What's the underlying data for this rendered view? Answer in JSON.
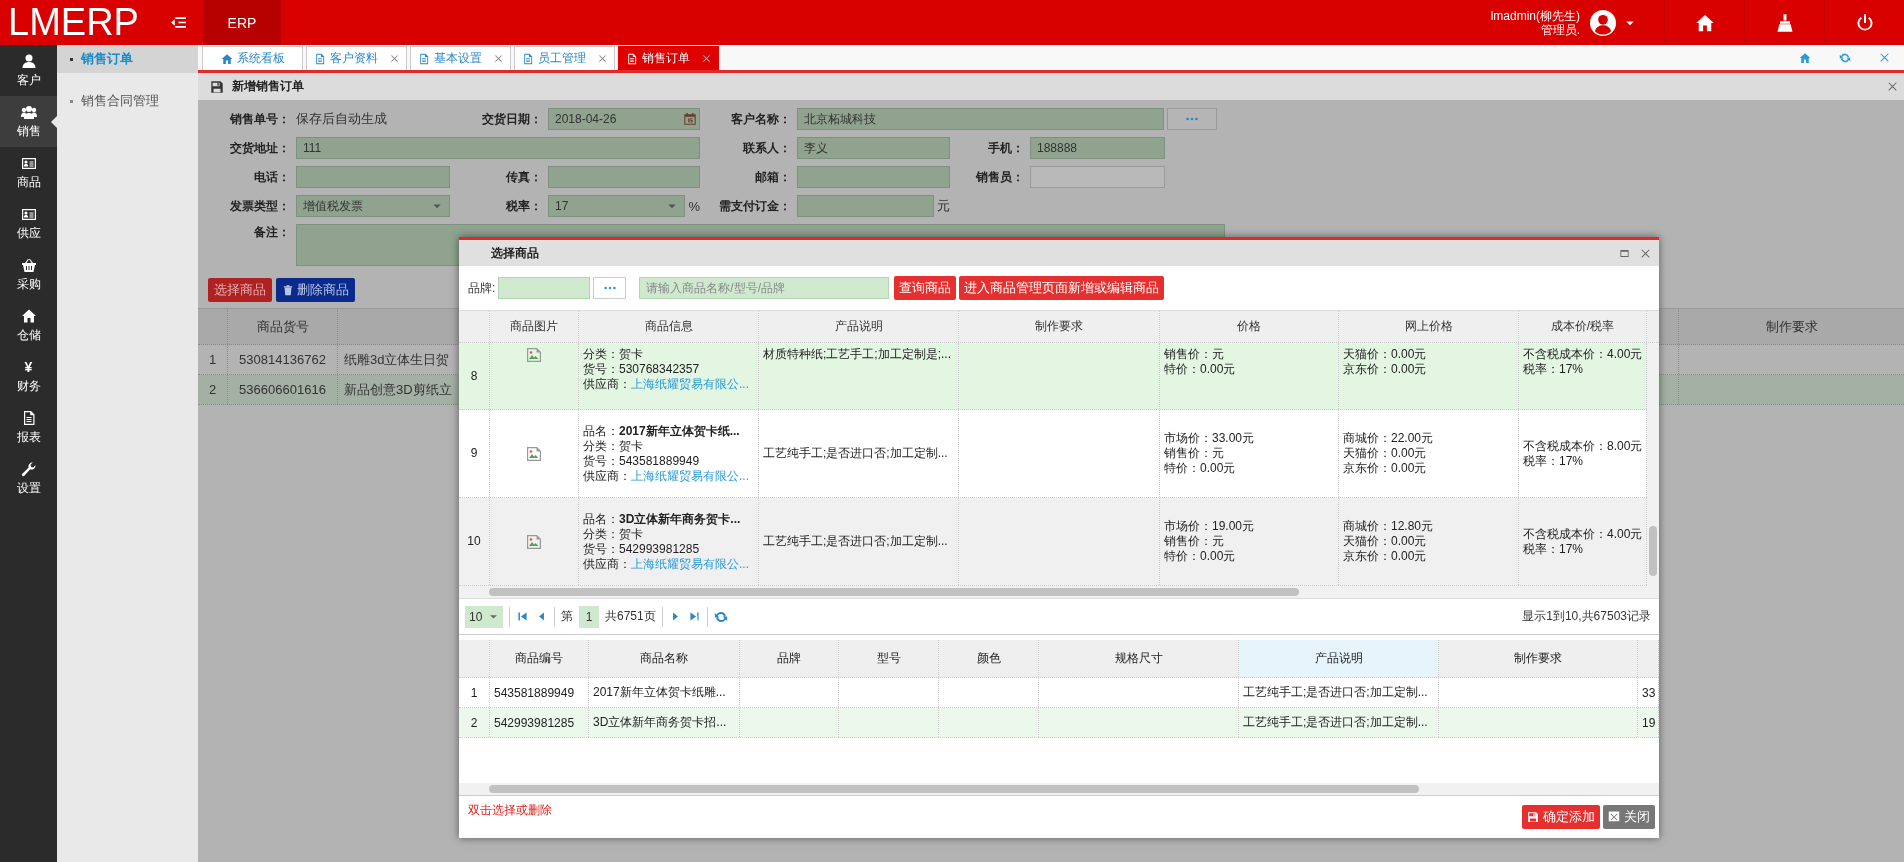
{
  "header": {
    "logo": "LMERP",
    "module_tab": "ERP",
    "user_name": "lmadmin(柳先生)",
    "user_role": "管理员."
  },
  "sidebar": {
    "items": [
      {
        "label": "客户",
        "selected": false
      },
      {
        "label": "销售",
        "selected": true
      },
      {
        "label": "商品",
        "selected": false
      },
      {
        "label": "供应",
        "selected": false
      },
      {
        "label": "采购",
        "selected": false
      },
      {
        "label": "仓储",
        "selected": false
      },
      {
        "label": "财务",
        "glyph": "¥",
        "selected": false
      },
      {
        "label": "报表",
        "selected": false
      },
      {
        "label": "设置",
        "selected": false
      }
    ]
  },
  "submenu": {
    "items": [
      {
        "label": "销售订单",
        "selected": true
      },
      {
        "label": "销售合同管理",
        "selected": false
      }
    ]
  },
  "tabs": [
    {
      "label": "系统看板",
      "closable": false,
      "selected": false
    },
    {
      "label": "客户资料",
      "closable": true,
      "selected": false
    },
    {
      "label": "基本设置",
      "closable": true,
      "selected": false
    },
    {
      "label": "员工管理",
      "closable": true,
      "selected": false
    },
    {
      "label": "销售订单",
      "closable": true,
      "selected": true
    }
  ],
  "panel": {
    "title": "新增销售订单",
    "fields": [
      {
        "label": "销售单号：",
        "kind": "static",
        "value": "保存后自动生成"
      },
      {
        "label": "交货日期：",
        "kind": "date",
        "value": "2018-04-26"
      },
      {
        "label": "客户名称：",
        "kind": "lookup",
        "value": "北京柘城科技"
      },
      {
        "label": "交货地址：",
        "kind": "input",
        "value": "111"
      },
      {
        "label": "联系人：",
        "kind": "input",
        "value": "李义"
      },
      {
        "label": "手机：",
        "kind": "input",
        "value": "188888"
      },
      {
        "label": "电话：",
        "kind": "input"
      },
      {
        "label": "传真：",
        "kind": "input"
      },
      {
        "label": "邮箱：",
        "kind": "input"
      },
      {
        "label": "销售员：",
        "kind": "readonly"
      },
      {
        "label": "发票类型：",
        "kind": "select",
        "value": "增值税发票"
      },
      {
        "label": "税率：",
        "kind": "select",
        "value": "17",
        "unit": "%"
      },
      {
        "label": "需支付订金：",
        "kind": "input",
        "unit": "元"
      },
      {
        "label": "备注：",
        "kind": "textarea"
      }
    ],
    "buttons": [
      {
        "label": "选择商品",
        "kind": "primary"
      },
      {
        "label": "删除商品",
        "kind": "delete"
      }
    ],
    "table": {
      "columns": [
        "商品货号",
        "制作要求"
      ],
      "rows": [
        {
          "index": "1",
          "code": "530814136762",
          "name": "纸雕3d立体生日贺",
          "selected": false
        },
        {
          "index": "2",
          "code": "536606601616",
          "name": "新品创意3D剪纸立",
          "selected": true
        }
      ]
    }
  },
  "dialog": {
    "title": "选择商品",
    "brand_label": "品牌:",
    "search": {
      "placeholder": "请输入商品名称/型号/品牌"
    },
    "buttons": [
      "查询商品",
      "进入商品管理页面新增或编辑商品"
    ],
    "products": {
      "columns": [
        "商品图片",
        "商品信息",
        "产品说明",
        "制作要求",
        "价格",
        "网上价格",
        "成本价/税率"
      ],
      "rows": [
        {
          "index": "8",
          "selected": true,
          "hover": false,
          "info": [
            "分类：贺卡",
            "货号：530768342357"
          ],
          "supplier_label": "供应商：",
          "supplier": "上海纸耀贸易有限公...",
          "description": "材质特种纸;工艺手工;加工定制是;...",
          "price": [
            "销售价：元",
            "特价：0.00元"
          ],
          "online_price": [
            "天猫价：0.00元",
            "京东价：0.00元"
          ],
          "cost": [
            "不含税成本价：4.00元",
            "税率：17%"
          ]
        },
        {
          "index": "9",
          "selected": false,
          "hover": false,
          "info": [
            "品名：**2017新年立体贺卡纸...**",
            "分类：贺卡",
            "货号：543581889949"
          ],
          "supplier_label": "供应商：",
          "supplier": "上海纸耀贸易有限公...",
          "description": "工艺纯手工;是否进口否;加工定制...",
          "price": [
            "市场价：33.00元",
            "销售价：元",
            "特价：0.00元"
          ],
          "online_price": [
            "商城价：22.00元",
            "天猫价：0.00元",
            "京东价：0.00元"
          ],
          "cost": [
            "不含税成本价：8.00元",
            "税率：17%"
          ]
        },
        {
          "index": "10",
          "selected": false,
          "hover": true,
          "info": [
            "品名：**3D立体新年商务贺卡...**",
            "分类：贺卡",
            "货号：542993981285"
          ],
          "supplier_label": "供应商：",
          "supplier": "上海纸耀贸易有限公...",
          "description": "工艺纯手工;是否进口否;加工定制...",
          "price": [
            "市场价：19.00元",
            "销售价：元",
            "特价：0.00元"
          ],
          "online_price": [
            "商城价：12.80元",
            "天猫价：0.00元",
            "京东价：0.00元"
          ],
          "cost": [
            "不含税成本价：4.00元",
            "税率：17%"
          ]
        }
      ]
    },
    "pager": {
      "page_size": "10",
      "page_prefix": "第",
      "page": "1",
      "page_total": "共6751页",
      "summary": "显示1到10,共67503记录"
    },
    "chosen": {
      "columns": [
        {
          "label": "商品编号",
          "highlighted": false
        },
        {
          "label": "商品名称",
          "highlighted": false
        },
        {
          "label": "品牌",
          "highlighted": false
        },
        {
          "label": "型号",
          "highlighted": false
        },
        {
          "label": "颜色",
          "highlighted": false
        },
        {
          "label": "规格尺寸",
          "highlighted": false
        },
        {
          "label": "产品说明",
          "highlighted": true
        },
        {
          "label": "制作要求",
          "highlighted": false
        }
      ],
      "rows": [
        {
          "index": "1",
          "code": "543581889949",
          "name": "2017新年立体贺卡纸雕...",
          "description": "工艺纯手工;是否进口否;加工定制...",
          "column_10": "33",
          "selected": false
        },
        {
          "index": "2",
          "code": "542993981285",
          "name": "3D立体新年商务贺卡招...",
          "description": "工艺纯手工;是否进口否;加工定制...",
          "column_10": "19",
          "selected": true
        }
      ]
    },
    "hint": "双击选择或删除",
    "footer_buttons": [
      {
        "label": "确定添加",
        "kind": "confirm"
      },
      {
        "label": "关闭",
        "kind": "close"
      }
    ]
  }
}
